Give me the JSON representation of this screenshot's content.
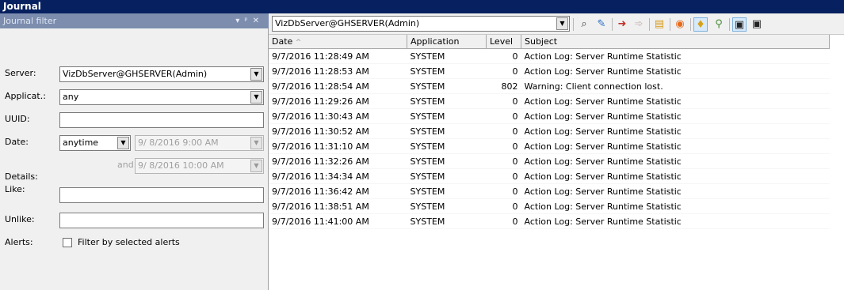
{
  "window": {
    "title": "Journal"
  },
  "filter_panel": {
    "title": "Journal filter",
    "server_label": "Server:",
    "server_value": "VizDbServer@GHSERVER(Admin)",
    "application_label": "Applicat.:",
    "application_value": "any",
    "uuid_label": "UUID:",
    "uuid_value": "",
    "date_label": "Date:",
    "date_mode": "anytime",
    "date_from": "9/ 8/2016  9:00 AM",
    "and_label": "and",
    "date_to": "9/ 8/2016 10:00 AM",
    "details_label": "Details:",
    "like_label": "Like:",
    "like_value": "",
    "unlike_label": "Unlike:",
    "unlike_value": "",
    "alerts_label": "Alerts:",
    "alerts_checkbox_label": "Filter by selected alerts"
  },
  "toolbar": {
    "server_select": "VizDbServer@GHSERVER(Admin)",
    "icons": [
      "search-icon",
      "clear-filter-icon",
      "export-icon",
      "forward-icon",
      "notes-icon",
      "alert-icon",
      "pin-icon",
      "statistics-icon",
      "panel-layout-icon",
      "window-icon"
    ]
  },
  "table": {
    "columns": [
      "Date",
      "Application",
      "Level",
      "Subject"
    ],
    "sort_indicator": "^",
    "rows": [
      [
        "9/7/2016 11:28:49 AM",
        "SYSTEM",
        "0",
        "Action Log: Server Runtime Statistic"
      ],
      [
        "9/7/2016 11:28:53 AM",
        "SYSTEM",
        "0",
        "Action Log: Server Runtime Statistic"
      ],
      [
        "9/7/2016 11:28:54 AM",
        "SYSTEM",
        "802",
        "Warning: Client connection lost."
      ],
      [
        "9/7/2016 11:29:26 AM",
        "SYSTEM",
        "0",
        "Action Log: Server Runtime Statistic"
      ],
      [
        "9/7/2016 11:30:43 AM",
        "SYSTEM",
        "0",
        "Action Log: Server Runtime Statistic"
      ],
      [
        "9/7/2016 11:30:52 AM",
        "SYSTEM",
        "0",
        "Action Log: Server Runtime Statistic"
      ],
      [
        "9/7/2016 11:31:10 AM",
        "SYSTEM",
        "0",
        "Action Log: Server Runtime Statistic"
      ],
      [
        "9/7/2016 11:32:26 AM",
        "SYSTEM",
        "0",
        "Action Log: Server Runtime Statistic"
      ],
      [
        "9/7/2016 11:34:34 AM",
        "SYSTEM",
        "0",
        "Action Log: Server Runtime Statistic"
      ],
      [
        "9/7/2016 11:36:42 AM",
        "SYSTEM",
        "0",
        "Action Log: Server Runtime Statistic"
      ],
      [
        "9/7/2016 11:38:51 AM",
        "SYSTEM",
        "0",
        "Action Log: Server Runtime Statistic"
      ],
      [
        "9/7/2016 11:41:00 AM",
        "SYSTEM",
        "0",
        "Action Log: Server Runtime Statistic"
      ]
    ]
  }
}
